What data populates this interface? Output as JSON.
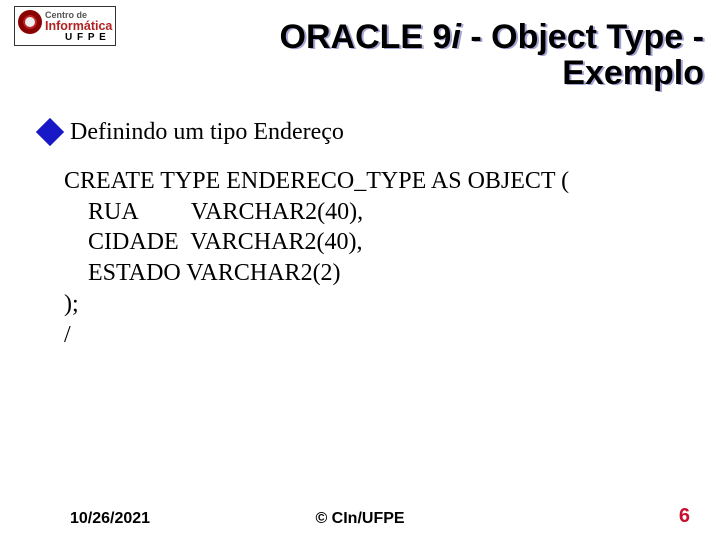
{
  "logo": {
    "line1": "Centro de",
    "line2": "Informática",
    "sub": "U F P E"
  },
  "title": {
    "line1_a": "ORACLE 9",
    "line1_i": "i",
    "line1_b": "  - Object Type -",
    "line2": "Exemplo"
  },
  "bullet": {
    "text": "Definindo um tipo Endereço"
  },
  "code": {
    "l1": "CREATE TYPE ENDERECO_TYPE AS OBJECT (",
    "l2": "    RUA         VARCHAR2(40),",
    "l3": "    CIDADE  VARCHAR2(40),",
    "l4": "    ESTADO VARCHAR2(2)",
    "l5": ");",
    "l6": "/"
  },
  "footer": {
    "date": "10/26/2021",
    "copyright": "© CIn/UFPE",
    "page": "6"
  }
}
